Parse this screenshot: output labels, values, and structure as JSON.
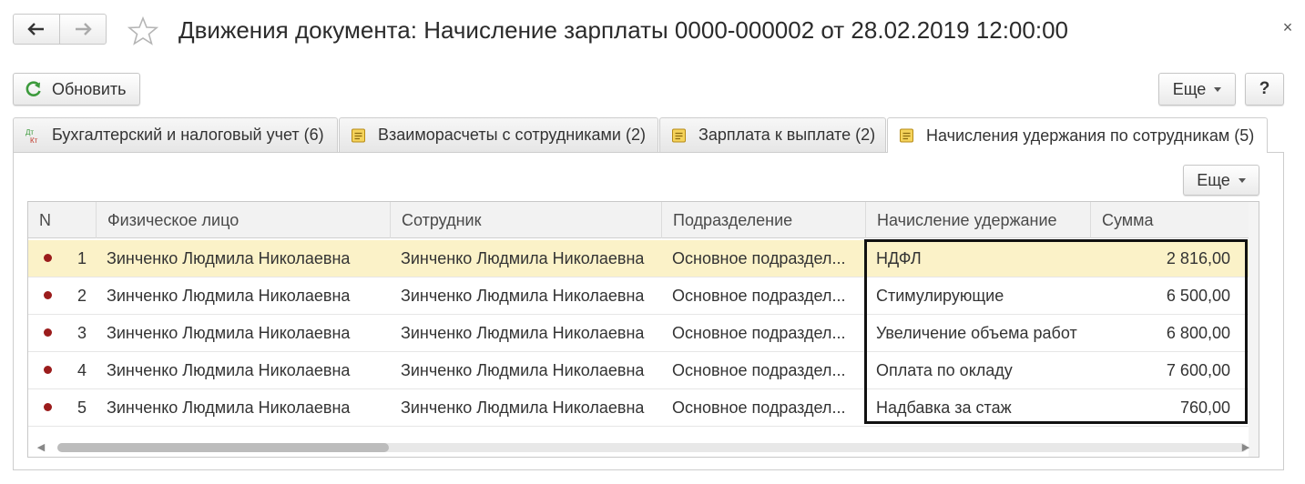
{
  "window": {
    "title": "Движения документа: Начисление зарплаты 0000-000002 от 28.02.2019 12:00:00",
    "close_label": "×"
  },
  "nav": {
    "back_icon": "arrow-left-icon",
    "forward_icon": "arrow-right-icon",
    "favorite_icon": "star-icon"
  },
  "toolbar": {
    "refresh_label": "Обновить",
    "more_label": "Еще",
    "help_label": "?"
  },
  "tabs": [
    {
      "label": "Бухгалтерский и налоговый учет (6)",
      "icon": "dt-kt-icon"
    },
    {
      "label": "Взаиморасчеты с сотрудниками (2)",
      "icon": "register-icon"
    },
    {
      "label": "Зарплата к выплате (2)",
      "icon": "register-icon"
    },
    {
      "label": "Начисления удержания по сотрудникам (5)",
      "icon": "register-icon",
      "active": true
    }
  ],
  "tab_toolbar": {
    "more_label": "Еще"
  },
  "table": {
    "columns": [
      "N",
      "Физическое лицо",
      "Сотрудник",
      "Подразделение",
      "Начисление удержание",
      "Сумма"
    ],
    "rows": [
      {
        "n": "1",
        "person": "Зинченко Людмила Николаевна",
        "employee": "Зинченко Людмила Николаевна",
        "department": "Основное подраздел...",
        "accrual": "НДФЛ",
        "sum": "2 816,00",
        "selected": true
      },
      {
        "n": "2",
        "person": "Зинченко Людмила Николаевна",
        "employee": "Зинченко Людмила Николаевна",
        "department": "Основное подраздел...",
        "accrual": "Стимулирующие",
        "sum": "6 500,00"
      },
      {
        "n": "3",
        "person": "Зинченко Людмила Николаевна",
        "employee": "Зинченко Людмила Николаевна",
        "department": "Основное подраздел...",
        "accrual": "Увеличение объема работ",
        "sum": "6 800,00"
      },
      {
        "n": "4",
        "person": "Зинченко Людмила Николаевна",
        "employee": "Зинченко Людмила Николаевна",
        "department": "Основное подраздел...",
        "accrual": "Оплата по окладу",
        "sum": "7 600,00"
      },
      {
        "n": "5",
        "person": "Зинченко Людмила Николаевна",
        "employee": "Зинченко Людмила Николаевна",
        "department": "Основное подраздел...",
        "accrual": "Надбавка за стаж",
        "sum": "760,00"
      }
    ]
  },
  "colors": {
    "selected_row": "#fbf2c8",
    "row_marker": "#9b1c1c",
    "refresh_icon": "#3c9a3c"
  }
}
